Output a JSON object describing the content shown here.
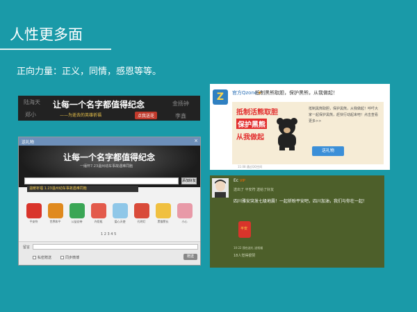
{
  "slide": {
    "title": "人性更多面",
    "subtitle": "正向力量：正义，同情，感恩等等。"
  },
  "banner": {
    "bg_names": [
      "陆海天",
      "金扬钟",
      "郑小",
      "李鑫"
    ],
    "headline": "让每一个名字都值得纪念",
    "subline": "——为逝去的英雄祈福",
    "button": "点我送花"
  },
  "window": {
    "title": "送礼物",
    "close": "×",
    "hero_headline": "让每一个名字都值得纪念",
    "hero_subline": "一缅怀7.23温州动车事故遇难同胞",
    "search_button": "添加好友",
    "notice": "温暖祈福 1.23温州动车事故遇难同胞",
    "gifts": [
      {
        "label": "平安符",
        "color": "#d9342b"
      },
      {
        "label": "世界和平",
        "color": "#e08a1e"
      },
      {
        "label": "公益丝带",
        "color": "#3aa655"
      },
      {
        "label": "许愿瓶",
        "color": "#e35a4b"
      },
      {
        "label": "爱心天使",
        "color": "#8fc7e8"
      },
      {
        "label": "孔明灯",
        "color": "#d94b3a"
      },
      {
        "label": "黑猫警长",
        "color": "#f0c040"
      },
      {
        "label": "小心",
        "color": "#e89aa8"
      }
    ],
    "pager": "1 2 3 4 5",
    "footer_label": "留言",
    "check_private": "私密赠送",
    "check_sync": "同步微博",
    "send_button": "赠送"
  },
  "qzone_post": {
    "name": "官方Qzone",
    "star": "★",
    "text": "抵制黑熊取胆，保护黑熊，从我做起！",
    "slogan_1": "抵制活熊取胆",
    "slogan_2": "保护黑熊",
    "slogan_3": "从我做起",
    "desc": "抵制黑熊取胆，保护黑熊，从我做起！呼吁大家一起保护黑熊，赶快行动起来吧！点击查看更多>>",
    "gift_button": "送礼物",
    "meta": "11:08  通过QQ空间"
  },
  "comment": {
    "name": "Ec",
    "vip": "VIP",
    "line1": "送出了 平安符 送给了好友",
    "body": "四川雅安突发七级地震！一起祈盼平安吧，四川加油，我们与你在一起！",
    "charm_label": "平安",
    "time": "10:22  我也送礼 送祝福",
    "likes": "18人觉得很赞"
  }
}
